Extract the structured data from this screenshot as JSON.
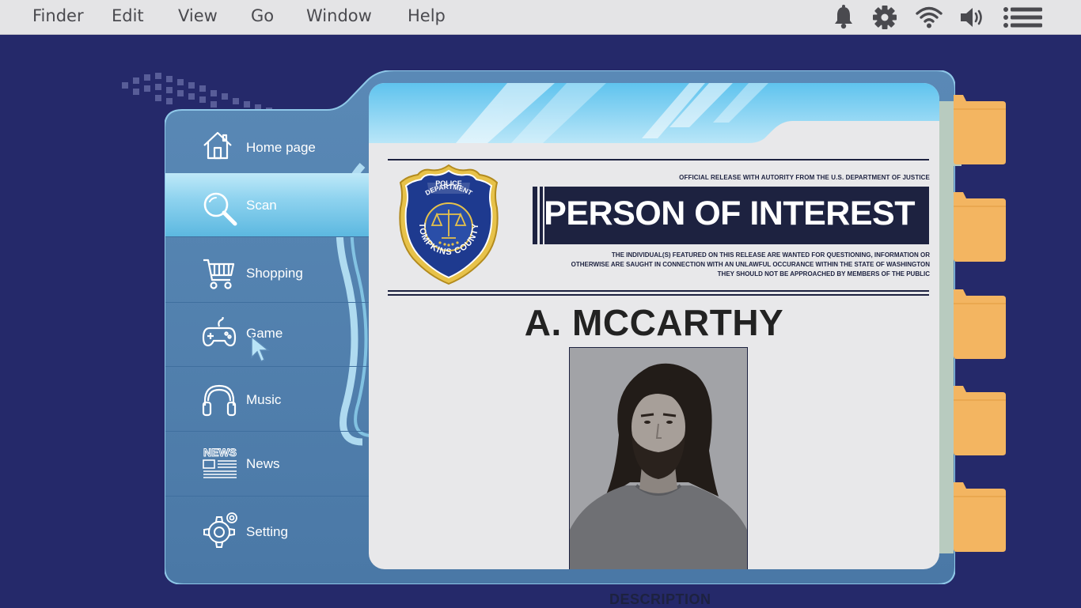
{
  "menubar": {
    "items": [
      "Finder",
      "Edit",
      "View",
      "Go",
      "Window",
      "Help"
    ],
    "tray_icons": [
      "bell-icon",
      "gear-icon",
      "wifi-icon",
      "speaker-icon",
      "list-icon"
    ]
  },
  "sidebar": {
    "items": [
      {
        "label": "Home page",
        "icon": "home-icon"
      },
      {
        "label": "Scan",
        "icon": "search-icon",
        "active": true
      },
      {
        "label": "Shopping",
        "icon": "cart-icon"
      },
      {
        "label": "Game",
        "icon": "gamepad-icon"
      },
      {
        "label": "Music",
        "icon": "headphones-icon"
      },
      {
        "label": "News",
        "icon": "news-icon"
      },
      {
        "label": "Setting",
        "icon": "gear-icon"
      }
    ]
  },
  "document": {
    "badge": {
      "top_text": "POLICE",
      "sub_text": "DEPARTMENT",
      "ring_text": "TOMPKINS COUNTY"
    },
    "official_line": "OFFICIAL RELEASE WITH AUTORITY FROM THE U.S. DEPARTMENT OF JUSTICE",
    "heading": "PERSON OF INTEREST",
    "warning_lines": [
      "THE INDIVIDUAL(S) FEATURED ON THIS RELEASE ARE WANTED FOR QUESTIONING, INFORMATION OR",
      "OTHERWISE ARE SAUGHT IN CONNECTION WITH AN UNLAWFUL OCCURANCE WITHIN THE STATE OF WASHINGTON",
      "THEY SHOULD NOT BE APPROACHED BY MEMBERS OF THE PUBLIC"
    ],
    "name": "A. MCCARTHY",
    "description_label": "DESCRIPTION"
  },
  "folders": [
    "folder-icon",
    "folder-icon",
    "folder-icon",
    "folder-icon",
    "folder-icon"
  ],
  "colors": {
    "background": "#25296a",
    "panel": "#4f7eab",
    "accent": "#8fd3ef",
    "document_navy": "#1d2240",
    "folder": "#f3b561"
  }
}
